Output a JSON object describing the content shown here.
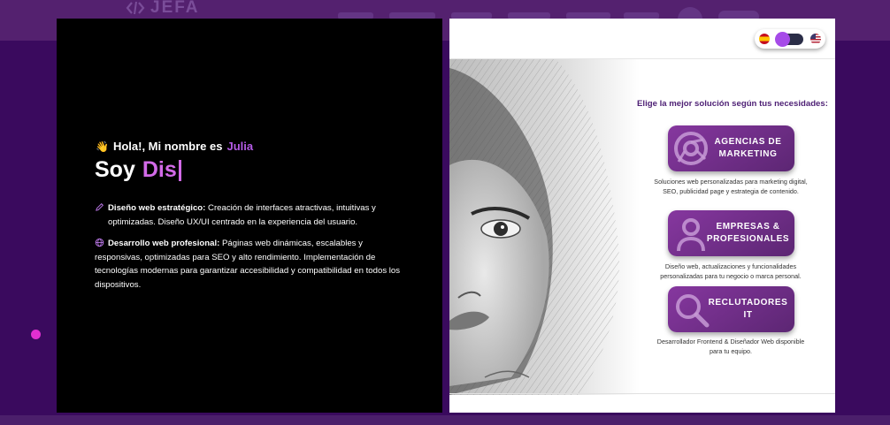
{
  "background": {
    "logo_text": "JEFA"
  },
  "intro": {
    "wave_emoji": "👋",
    "greeting_prefix": "Hola!, Mi nombre es",
    "name": "Julia",
    "headline_static": "Soy",
    "headline_typed": "Dis"
  },
  "services": [
    {
      "icon": "pencil-icon",
      "title": "Diseño web estratégico:",
      "line1": " Creación de interfaces atractivas, intuitivas y",
      "line2": "optimizadas. Diseño UX/UI centrado en la experiencia del usuario."
    },
    {
      "icon": "globe-icon",
      "title": "Desarrollo web profesional:",
      "line1": " Páginas web dinámicas, escalables y",
      "line2": "responsivas, optimizadas para SEO y alto rendimiento. Implementación de",
      "line3": "tecnologías modernas para garantizar accesibilidad y compatibilidad en todos los",
      "line4": "dispositivos."
    }
  ],
  "language_switch": {
    "left_flag": "spain-flag-icon",
    "right_flag": "usa-flag-icon",
    "state": "es"
  },
  "solutions": {
    "prompt": "Elige la mejor solución según tus necesidades:",
    "cards": [
      {
        "icon": "target-icon",
        "label": "AGENCIAS DE\nMARKETING",
        "description": "Soluciones web personalizadas para marketing digital, SEO, publicidad page y estrategia de contenido."
      },
      {
        "icon": "user-icon",
        "label": "EMPRESAS &\nPROFESIONALES",
        "description": "Diseño web, actualizaciones y funcionalidades personalizadas para tu negocio o marca personal."
      },
      {
        "icon": "search-icon",
        "label": "RECLUTADORES\nIT",
        "description": "Desarrollador Frontend & Diseñador Web disponible para tu equipo."
      }
    ]
  },
  "colors": {
    "page_bg": "#3a0a5e",
    "accent": "#b45be6",
    "card_gradient_start": "#86379f",
    "card_gradient_end": "#5c2673",
    "prompt_color": "#4d1f74"
  }
}
